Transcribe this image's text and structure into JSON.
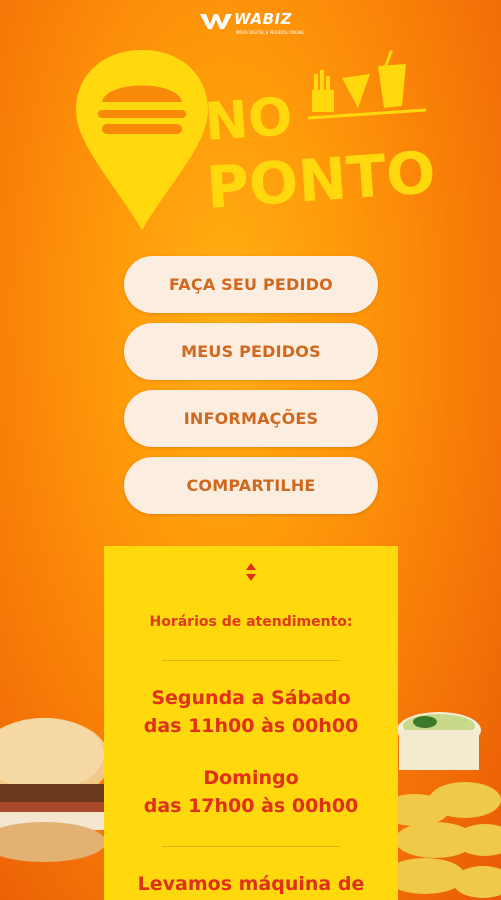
{
  "header": {
    "wabiz_logo_text": "WABIZ",
    "wabiz_tagline": "MÍDIA DIGITAL E PEDIDOS ONLINE"
  },
  "brand": {
    "line1": "NO",
    "line2": "PONTO"
  },
  "menu": {
    "items": [
      {
        "label": "FAÇA SEU PEDIDO"
      },
      {
        "label": "MEUS PEDIDOS"
      },
      {
        "label": "INFORMAÇÕES"
      },
      {
        "label": "COMPARTILHE"
      }
    ]
  },
  "info": {
    "title": "Horários de atendimento:",
    "schedule1_days": "Segunda a Sábado",
    "schedule1_time": "das 11h00 às 00h00",
    "schedule2_days": "Domingo",
    "schedule2_time": "das 17h00 às 00h00",
    "notice": "Levamos máquina de"
  },
  "colors": {
    "background": "#f98a0a",
    "brand_yellow": "#ffd80d",
    "button_bg": "#fbeee0",
    "button_text": "#d1681e",
    "schedule_text": "#e0301a"
  }
}
